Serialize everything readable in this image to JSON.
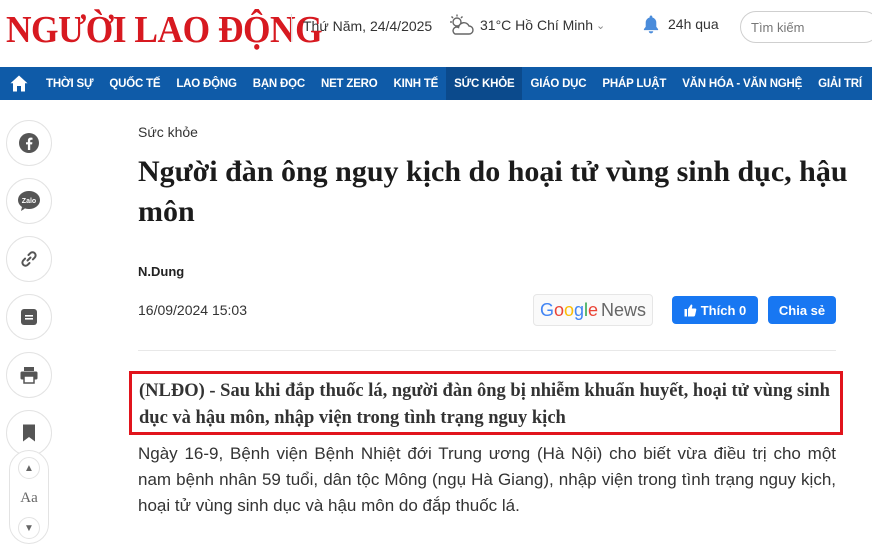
{
  "header": {
    "logo_text": "NGƯỜI LAO ĐỘNG",
    "date": "Thứ Năm, 24/4/2025",
    "weather": "31°C Hồ Chí Minh",
    "notifications": "24h qua",
    "search_placeholder": "Tìm kiếm",
    "brand_color": "#d71920"
  },
  "nav": {
    "bg_color": "#0f5ba8",
    "items": [
      {
        "label": "THỜI SỰ"
      },
      {
        "label": "QUỐC TẾ"
      },
      {
        "label": "LAO ĐỘNG"
      },
      {
        "label": "BẠN ĐỌC"
      },
      {
        "label": "NET ZERO"
      },
      {
        "label": "KINH TẾ"
      },
      {
        "label": "SỨC KHỎE",
        "active": true
      },
      {
        "label": "GIÁO DỤC"
      },
      {
        "label": "PHÁP LUẬT"
      },
      {
        "label": "VĂN HÓA - VĂN NGHỆ"
      },
      {
        "label": "GIẢI TRÍ"
      }
    ]
  },
  "share_rail": {
    "icons": [
      "facebook-icon",
      "zalo-icon",
      "link-icon",
      "comment-icon",
      "print-icon",
      "bookmark-icon"
    ],
    "font_size_label": "Aa"
  },
  "article": {
    "category": "Sức khỏe",
    "title": "Người đàn ông nguy kịch do hoại tử vùng sinh dục, hậu môn",
    "author": "N.Dung",
    "datetime": "16/09/2024 15:03",
    "google_news": {
      "g": "G",
      "o1": "o",
      "o2": "o",
      "g2": "g",
      "l": "l",
      "e": "e",
      "news": "News"
    },
    "like_label": "Thích 0",
    "share_label": "Chia sẻ",
    "sapo": "(NLĐO) - Sau khi đắp thuốc lá, người đàn ông bị nhiễm khuẩn huyết, hoại tử vùng sinh dục và hậu môn, nhập viện trong tình trạng nguy kịch",
    "highlight_color": "#e1141c",
    "body": "Ngày 16-9, Bệnh viện Bệnh Nhiệt đới Trung ương (Hà Nội) cho biết vừa điều trị cho một nam bệnh nhân 59 tuổi, dân tộc Mông (ngụ Hà Giang), nhập viện trong tình trạng nguy kịch, hoại tử vùng sinh dục và hậu môn do đắp thuốc lá."
  }
}
